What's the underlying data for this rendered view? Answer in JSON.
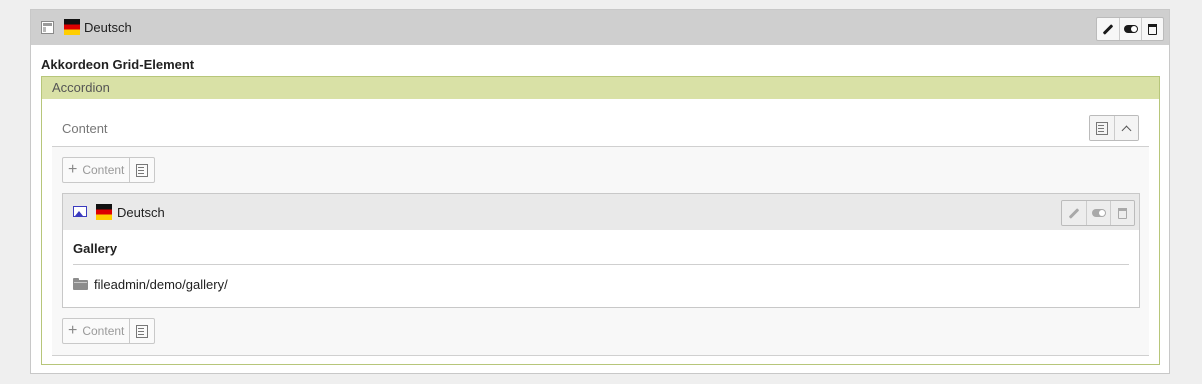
{
  "outer_element": {
    "language": "Deutsch",
    "icons": [
      "content-element-icon",
      "flag-de-icon",
      "edit-icon",
      "toggle-visibility-icon",
      "delete-icon"
    ],
    "title": "Akkordeon Grid-Element"
  },
  "accordion": {
    "header": "Accordion",
    "column_label": "Content",
    "add_content_label": "Content",
    "add_content_label_2": "Content"
  },
  "inner_element": {
    "language": "Deutsch",
    "title": "Gallery",
    "folder_path": "fileadmin/demo/gallery/",
    "icons": [
      "image-type-icon",
      "flag-de-icon",
      "edit-icon",
      "toggle-visibility-icon",
      "delete-icon",
      "folder-icon"
    ]
  },
  "colors": {
    "header_bg": "#cfcfcf",
    "accordion_head_bg": "#d9e1a6",
    "accordion_border": "#b7c67a",
    "image_icon": "#3b3bbf"
  }
}
